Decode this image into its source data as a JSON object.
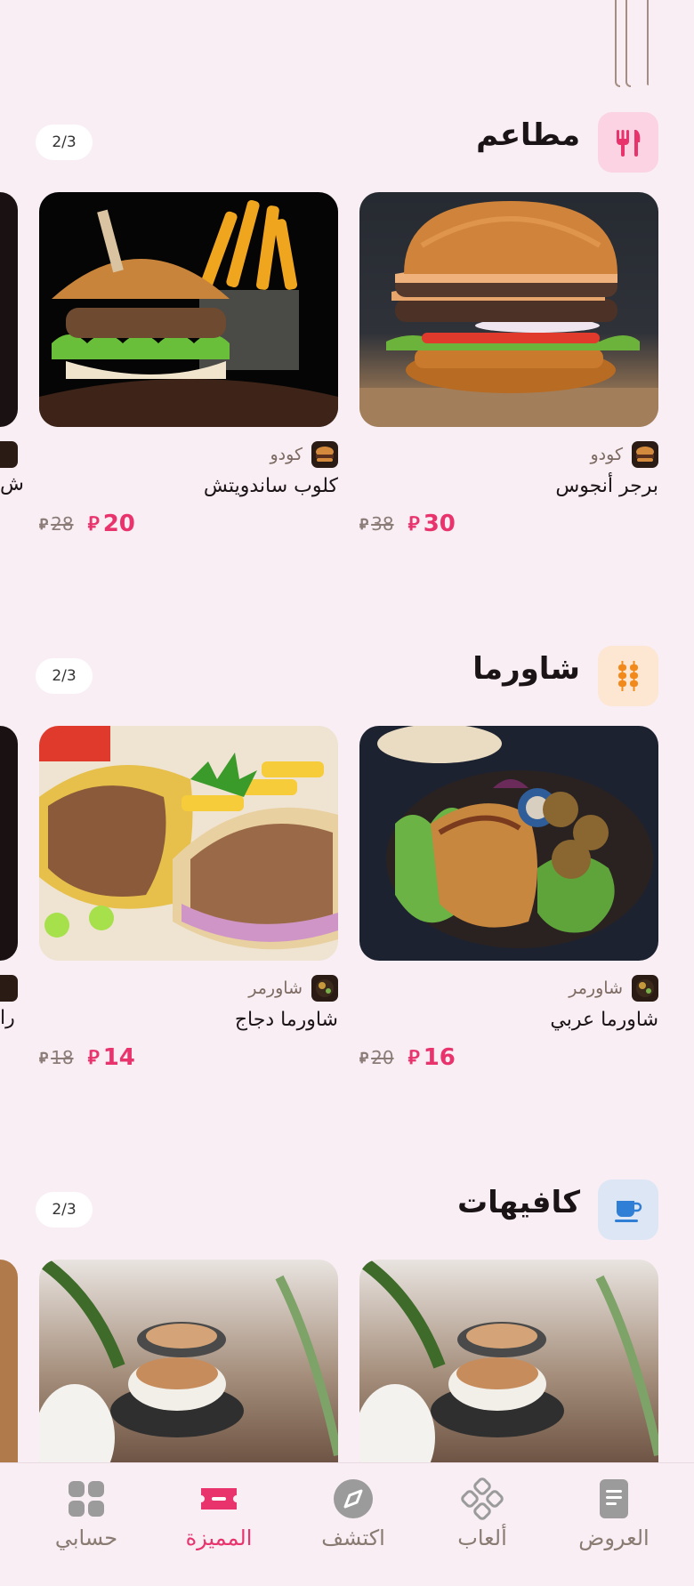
{
  "sections": [
    {
      "title": "مطاعم",
      "icon": "utensils-icon",
      "pager": "2/3",
      "cards": [
        {
          "name": "برجر أنجوس",
          "vendor": "كودو",
          "price": "30",
          "old_price": "38"
        },
        {
          "name": "كلوب ساندويتش",
          "vendor": "كودو",
          "price": "20",
          "old_price": "28"
        }
      ],
      "peek_text": "ش"
    },
    {
      "title": "شاورما",
      "icon": "skewer-icon",
      "pager": "2/3",
      "cards": [
        {
          "name": "شاورما عربي",
          "vendor": "شاورمر",
          "price": "16",
          "old_price": "20"
        },
        {
          "name": "شاورما دجاج",
          "vendor": "شاورمر",
          "price": "14",
          "old_price": "18"
        }
      ],
      "peek_text": "را"
    },
    {
      "title": "كافيهات",
      "icon": "coffee-cup-icon",
      "pager": "2/3",
      "cards": []
    }
  ],
  "nav": [
    {
      "label": "العروض",
      "icon": "document-icon",
      "active": false
    },
    {
      "label": "ألعاب",
      "icon": "gamepad-icon",
      "active": false
    },
    {
      "label": "اكتشف",
      "icon": "compass-icon",
      "active": false
    },
    {
      "label": "المميزة",
      "icon": "ticket-icon",
      "active": true
    },
    {
      "label": "حسابي",
      "icon": "grid-icon",
      "active": false
    }
  ],
  "colors": {
    "accent": "#e8336d",
    "background": "#f8eef4",
    "muted": "#8a7b72"
  }
}
